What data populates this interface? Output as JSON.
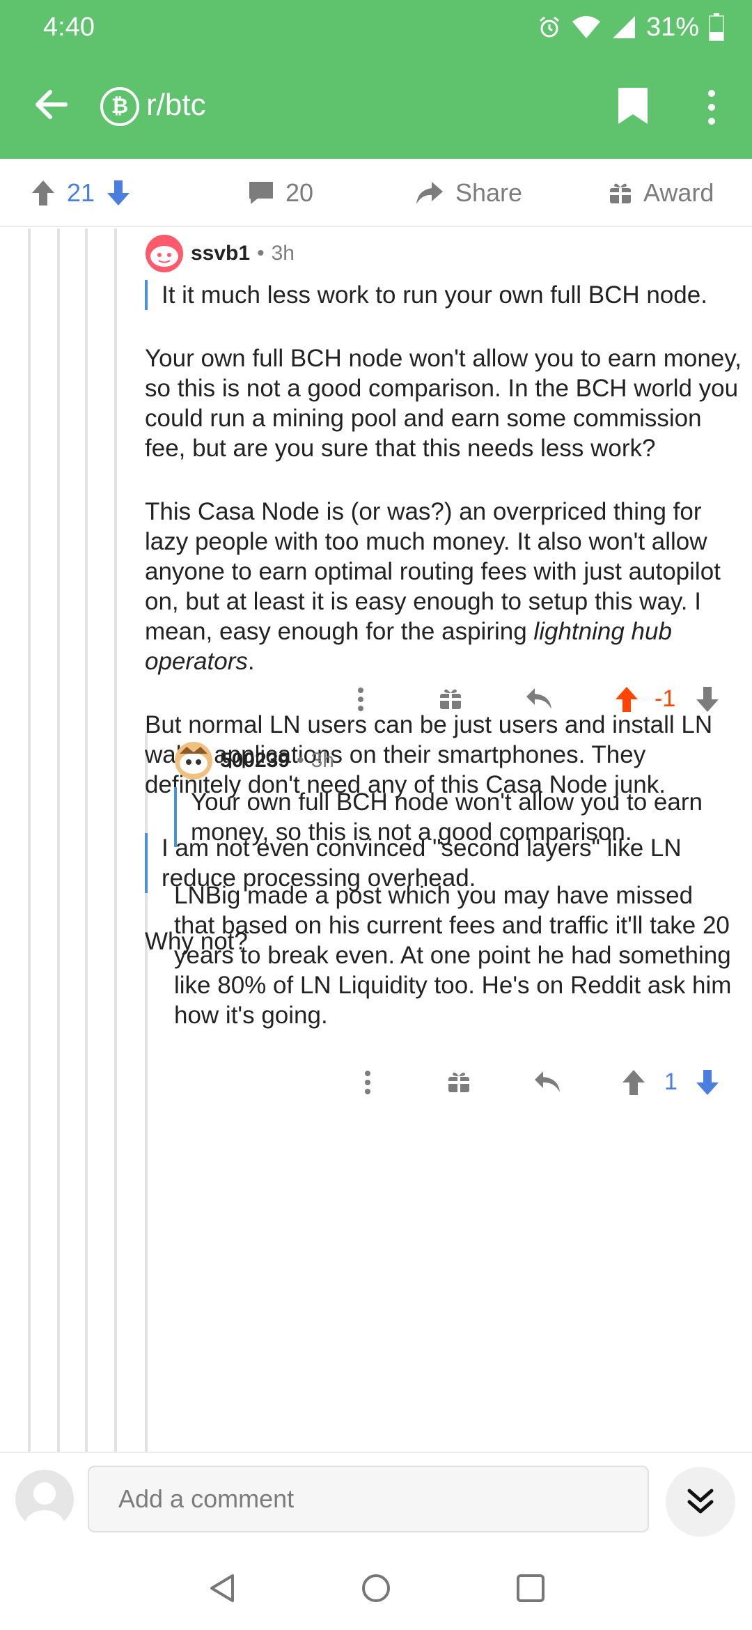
{
  "status_bar": {
    "time": "4:40",
    "battery_pct": "31%"
  },
  "app_bar": {
    "subreddit": "r/btc",
    "subreddit_icon_glyph": "₿"
  },
  "post_actions": {
    "upvotes": "21",
    "comments": "20",
    "share_label": "Share",
    "award_label": "Award"
  },
  "comments": [
    {
      "author": "ssvb1",
      "age": "3h",
      "quote1": "It it much less work to run your own full BCH node.",
      "para1": "Your own full BCH node won't allow you to earn money, so this is not a good comparison. In the BCH world you could run a mining pool and earn some commission fee, but are you sure that this needs less work?",
      "para2_a": "This Casa Node is (or was?) an overpriced thing for lazy people with too much money. It also won't allow anyone to earn optimal routing fees with just autopilot on, but at least it is easy enough to setup this way. I mean, easy enough for the aspiring ",
      "para2_em": "lightning hub operators",
      "para2_b": ".",
      "para3": "But normal LN users can be just users and install LN wallet applications on their smartphones. They definitely don't need any of this Casa Node junk.",
      "quote2": "I am not even convinced \"second layers\" like LN reduce processing overhead.",
      "para4": "Why not?",
      "score": "-1",
      "vote_state": "upvoted-orange"
    },
    {
      "author": "500239",
      "age": "3h",
      "quote1": "Your own full BCH node won't allow you to earn money, so this is not a good comparison.",
      "para1": "LNBig made a post which you may have missed that based on his current fees and traffic it'll take 20 years to break even. At one point he had something like 80% of LN Liquidity too. He's on Reddit ask him how it's going.",
      "score": "1",
      "vote_state": "downvoted-blue"
    }
  ],
  "composer": {
    "placeholder": "Add a comment"
  },
  "colors": {
    "header_green": "#5ec36c",
    "upvote_orange": "#ff4500",
    "downvote_blue": "#4a7fe0",
    "quote_bar": "#4a90d9"
  }
}
